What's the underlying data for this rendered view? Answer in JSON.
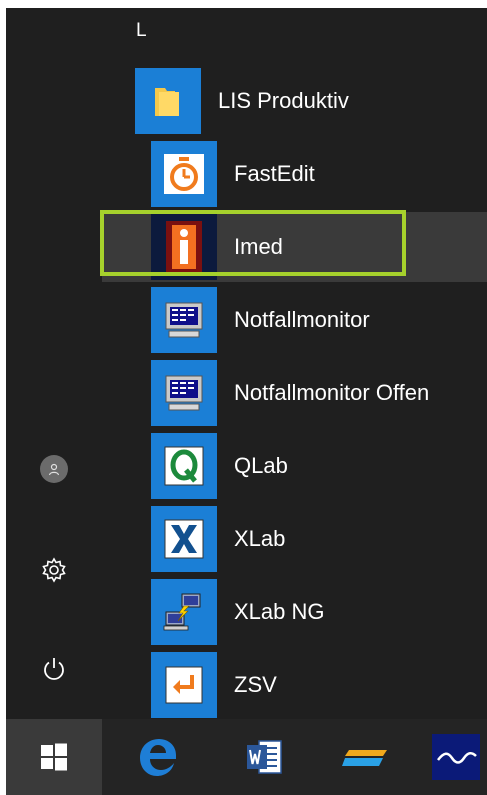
{
  "start_menu": {
    "section_letter": "L",
    "folder": {
      "label": "LIS Produktiv",
      "icon": "folder-icon"
    },
    "apps": [
      {
        "label": "FastEdit",
        "icon": "stopwatch-icon"
      },
      {
        "label": "Imed",
        "icon": "imed-i-icon",
        "selected": true
      },
      {
        "label": "Notfallmonitor",
        "icon": "monitor-icon"
      },
      {
        "label": "Notfallmonitor Offen",
        "icon": "monitor-icon"
      },
      {
        "label": "QLab",
        "icon": "qlab-q-icon"
      },
      {
        "label": "XLab",
        "icon": "xlab-x-icon"
      },
      {
        "label": "XLab NG",
        "icon": "network-computers-icon"
      },
      {
        "label": "ZSV",
        "icon": "return-arrow-icon"
      }
    ],
    "left_rail": [
      "user-icon",
      "settings-gear-icon",
      "power-icon"
    ]
  },
  "taskbar": {
    "items": [
      "windows-start-icon",
      "edge-browser-icon",
      "word-icon",
      "highlighter-app-icon",
      "waveform-app-icon"
    ]
  },
  "colors": {
    "accent_tile": "#1b7fd6",
    "highlight_border": "#a6d12c",
    "menu_bg": "#1f1f1f",
    "taskbar_bg": "#242424"
  }
}
